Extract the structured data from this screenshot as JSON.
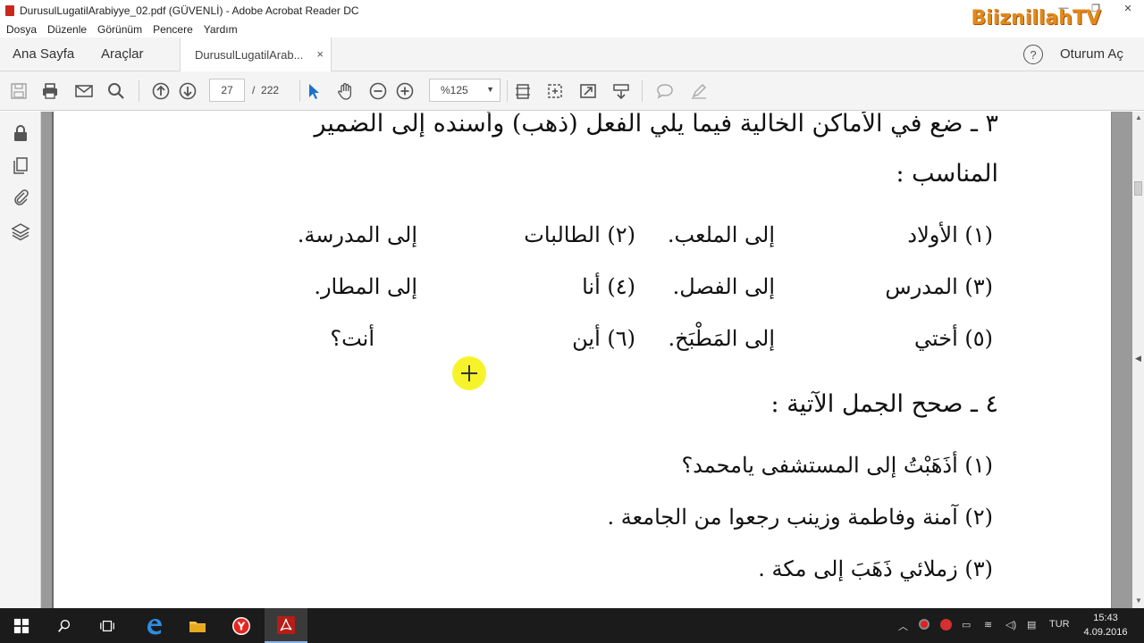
{
  "window": {
    "title": "DurusulLugatilArabiyye_02.pdf (GÜVENLİ) - Adobe Acrobat Reader DC",
    "controls": [
      "—",
      "❐",
      "✕"
    ]
  },
  "brand": "BiiznillahTV",
  "menu": [
    "Dosya",
    "Düzenle",
    "Görünüm",
    "Pencere",
    "Yardım"
  ],
  "nav": {
    "home": "Ana Sayfa",
    "tools": "Araçlar",
    "doc_tab": "DurusulLugatilArab...",
    "tab_close": "×",
    "help": "?",
    "login": "Oturum Aç"
  },
  "toolbar": {
    "page_current": "27",
    "page_separator": "/",
    "page_total": "222",
    "zoom": "%125",
    "zoom_arrow": "▼"
  },
  "document": {
    "ex3_heading": "٣ ـ ضع في الأماكن الخالية فيما يلي الفعل (ذهب) وأسنده إلى الضمير",
    "ex3_heading_cont": "المناسب :",
    "ex3_rows": [
      [
        "(١) الأولاد",
        "إلى الملعب.",
        "(٢) الطالبات",
        "إلى المدرسة."
      ],
      [
        "(٣) المدرس",
        "إلى الفصل.",
        "(٤) أنا",
        "إلى المطار."
      ],
      [
        "(٥) أختي",
        "إلى المَطْبَخ.",
        "(٦) أين",
        "أنت؟"
      ]
    ],
    "ex4_heading": "٤ ـ صحح الجمل الآتية :",
    "ex4_items": [
      "(١) أذَهَبْتُ إلى المستشفى يامحمد؟",
      "(٢) آمنة وفاطمة وزينب رجعوا من الجامعة .",
      "(٣) زملائي ذَهَبَ إلى مكة ."
    ]
  },
  "taskbar": {
    "language": "TUR",
    "time": "15:43",
    "date": "4.09.2016"
  },
  "colors": {
    "brand": "#e08a1a",
    "acrobat_red": "#c8281e",
    "taskbar": "#1b1b1b",
    "cursor_highlight": "#f7f21a"
  }
}
